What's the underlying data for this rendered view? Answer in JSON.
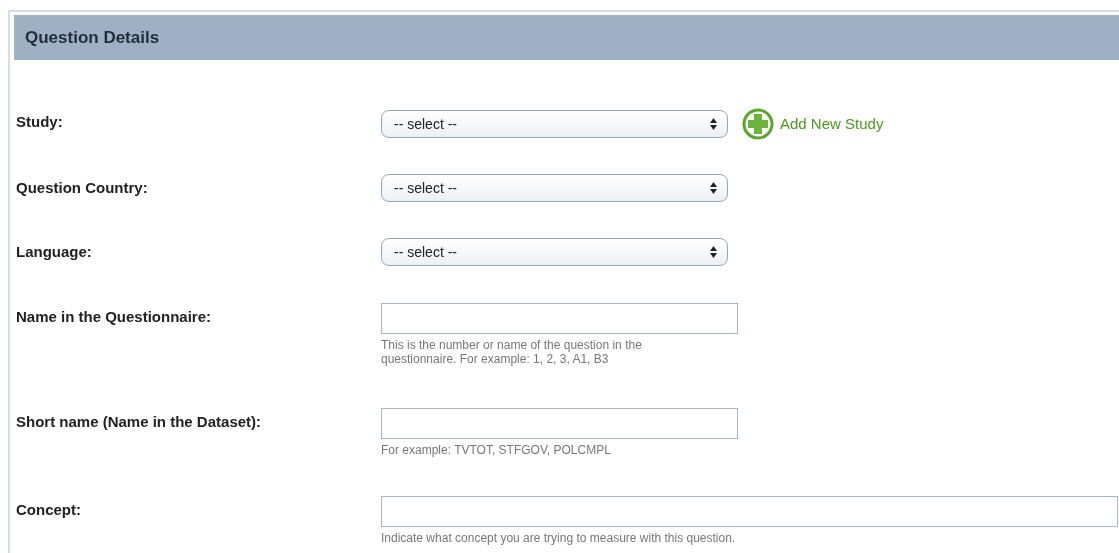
{
  "panel": {
    "title": "Question Details"
  },
  "fields": [
    {
      "label": "Study:",
      "kind": "select",
      "value": "-- select --",
      "action": "Add New Study"
    },
    {
      "label": "Question Country:",
      "kind": "select",
      "value": "-- select --"
    },
    {
      "label": "Language:",
      "kind": "select",
      "value": "-- select --"
    },
    {
      "label": "Name in the Questionnaire:",
      "kind": "text",
      "hint": "This is the number or name of the question in the questionnaire. For example: 1, 2, 3, A1, B3"
    },
    {
      "label": "Short name (Name in the Dataset):",
      "kind": "text",
      "hint": "For example: TVTOT, STFGOV, POLCMPL"
    },
    {
      "label": "Concept:",
      "kind": "wide",
      "hint": "Indicate what concept you are trying to measure with this question."
    }
  ]
}
